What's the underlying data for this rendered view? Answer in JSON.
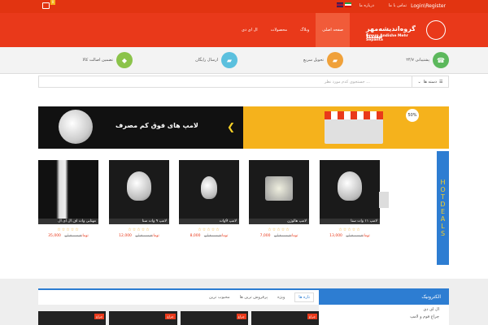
{
  "topbar": {
    "login": "Login\\Register",
    "about": "درباره ما",
    "contact": "تماس با ما",
    "cart_count": "0"
  },
  "header": {
    "logo_title": "گروه‌اندیشه‌مهر سپنتا",
    "logo_sub": "Group Andishe Mehr Sepanta"
  },
  "nav": [
    "صفحه اصلی",
    "وبلاگ",
    "محصولات",
    "ال ای دی"
  ],
  "features": [
    {
      "label": "پشتیبانی ۲۴/۷",
      "icon": "phone-icon",
      "color": "#5cb85c"
    },
    {
      "label": "تحویل سریع",
      "icon": "truck-icon",
      "color": "#f0a13a"
    },
    {
      "label": "ارسال رایگان",
      "icon": "free-shipping-icon",
      "color": "#5bc0de"
    },
    {
      "label": "تضمین اصالت کالا",
      "icon": "shield-icon",
      "color": "#8bc34a"
    }
  ],
  "search": {
    "category": "دسته ها",
    "placeholder": "جستجوی کدم مورد نظر ..."
  },
  "banner": {
    "text": "لامپ های فوق کم مصرف",
    "discount": "50%"
  },
  "hot_deals": [
    "H",
    "O",
    "T",
    "D",
    "E",
    "A",
    "L",
    "S"
  ],
  "products": [
    {
      "name": "لامپ ۱۱ وات سنا",
      "new": "13,000 تومان",
      "old": "قیمت قبلی"
    },
    {
      "name": "لامپ هالوژن",
      "new": "7,000 تومان",
      "old": "قیمت قبلی"
    },
    {
      "name": "لامپ 9وات",
      "new": "8,000 تومان",
      "old": "قیمت قبلی"
    },
    {
      "name": "لامپ ۹ وات سنا",
      "new": "12,000 تومان",
      "old": "قیمت قبلی"
    },
    {
      "name": "مهتابی وات اف ال ای ال",
      "new": "35,000 تومان",
      "old": "قیمت قبلی"
    }
  ],
  "stars": "☆☆☆☆☆",
  "tabs": [
    "تازه ها",
    "ویژه",
    "پرفروش ترین ها",
    "محبوب ترین"
  ],
  "sidebar": {
    "title": "الکترونیک",
    "items": [
      "ال ای دی",
      "چراغ فوم و لامپ"
    ]
  },
  "thumb_label": "چراغ"
}
